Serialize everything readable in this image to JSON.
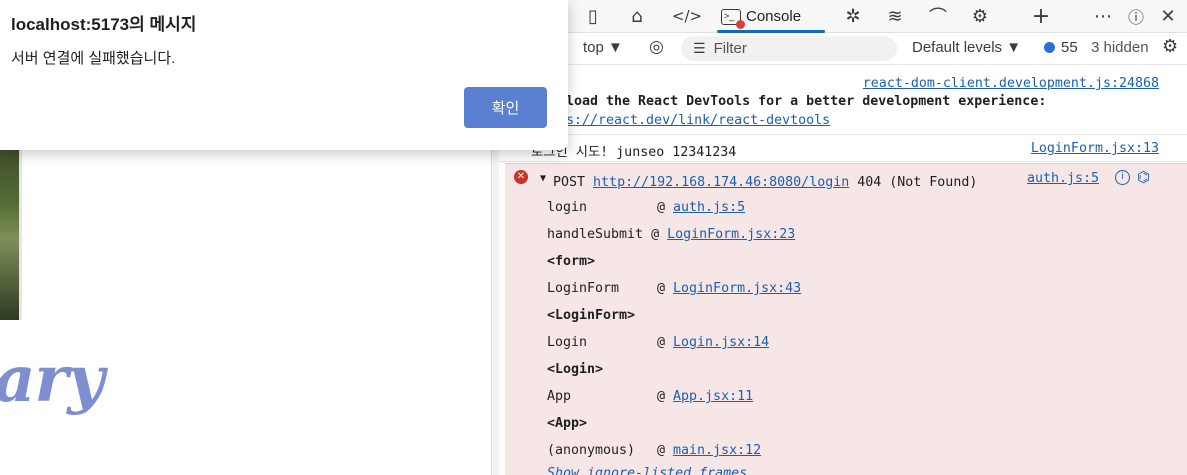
{
  "dialog": {
    "title": "localhost:5173의 메시지",
    "message": "서버 연결에 실패했습니다.",
    "ok_label": "확인"
  },
  "page": {
    "brand_fragment": "ary"
  },
  "devtools": {
    "tabs": {
      "console_label": "Console"
    },
    "toolbar": {
      "context": "top",
      "filter_placeholder": "Filter",
      "levels": "Default levels",
      "message_count": "55",
      "hidden": "3 hidden"
    },
    "console": {
      "msg1_source": "react-dom-client.development.js:24868",
      "msg1_line2": "load the React DevTools for a better development experience:",
      "msg1_line3": "s://react.dev/link/react-devtools",
      "msg2_text": "로그인 시도! junseo 12341234",
      "msg2_source": "LoginForm.jsx:13",
      "error": {
        "method": "POST",
        "url": "http://192.168.174.46:8080/login",
        "status": "404 (Not Found)",
        "source": "auth.js:5",
        "stack": [
          {
            "fn": "login",
            "at": "@",
            "loc": "auth.js:5"
          },
          {
            "fn": "handleSubmit",
            "at": "@",
            "loc": "LoginForm.jsx:23"
          },
          {
            "tag": "<form>"
          },
          {
            "fn": "LoginForm",
            "at": "@",
            "loc": "LoginForm.jsx:43"
          },
          {
            "tag": "<LoginForm>"
          },
          {
            "fn": "Login",
            "at": "@",
            "loc": "Login.jsx:14"
          },
          {
            "tag": "<Login>"
          },
          {
            "fn": "App",
            "at": "@",
            "loc": "App.jsx:11"
          },
          {
            "tag": "<App>"
          },
          {
            "fn": "(anonymous)",
            "at": "@",
            "loc": "main.jsx:12"
          }
        ],
        "show_ignored": "Show ignore-listed frames"
      }
    }
  }
}
